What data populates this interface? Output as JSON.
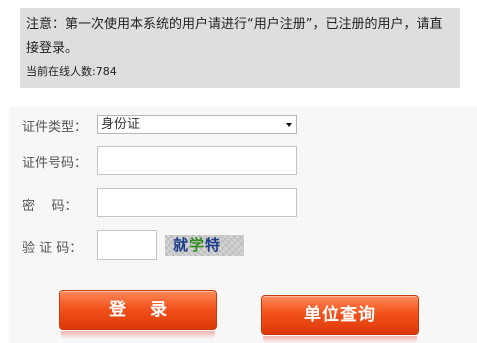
{
  "notice": {
    "text": "注意：第一次使用本系统的用户请进行“用户注册”，已注册的用户，请直接登录。",
    "online_label": "当前在线人数:",
    "online_count": "784"
  },
  "form": {
    "id_type": {
      "label": "证件类型：",
      "selected": "身份证"
    },
    "id_number": {
      "label": "证件号码：",
      "value": ""
    },
    "password": {
      "label": "密    码：",
      "value": ""
    },
    "captcha": {
      "label": "验 证 码：",
      "value": "",
      "image_chars": [
        "就",
        "学",
        "特"
      ]
    }
  },
  "buttons": {
    "login_label": "登录",
    "query_label": "单位查询"
  },
  "colors": {
    "button_orange": "#f2521c",
    "notice_bg": "#dedede"
  }
}
